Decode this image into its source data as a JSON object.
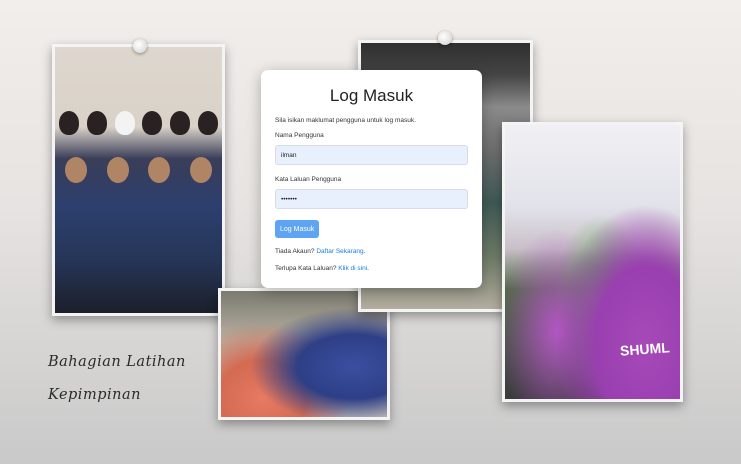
{
  "login": {
    "title": "Log Masuk",
    "subtitle": "Sila isikan maklumat pengguna untuk log masuk.",
    "username_label": "Nama Pengguna",
    "username_value": "ilman",
    "password_label": "Kata Laluan Pengguna",
    "password_value": "•••••••",
    "button_label": "Log Masuk",
    "no_account_text": "Tiada Akaun?",
    "register_link": "Daftar Sekarang",
    "register_suffix": ".",
    "forgot_text": "Terlupa Kata Laluan?",
    "forgot_link": "Klik di sini",
    "forgot_suffix": "."
  },
  "caption": {
    "line1": "Bahagian Latihan",
    "line2": "Kepimpinan"
  },
  "photos": {
    "crowd_shirt_text": "SHUML"
  },
  "colors": {
    "button": "#5ea4f2",
    "link": "#1a7fe0",
    "input_bg": "#e8f0fe"
  }
}
